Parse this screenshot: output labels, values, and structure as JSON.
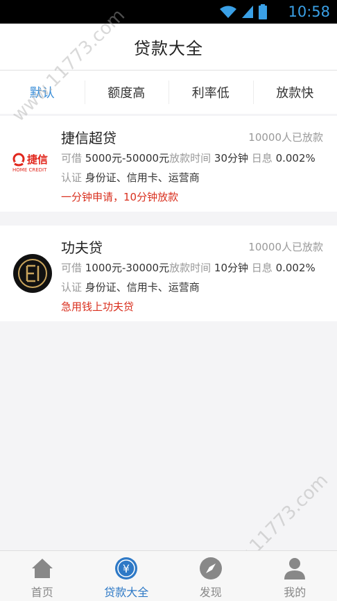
{
  "status_bar": {
    "time": "10:58",
    "icons": [
      "wifi-icon",
      "cell-signal-icon",
      "battery-icon"
    ]
  },
  "header": {
    "title": "贷款大全"
  },
  "tabs": [
    {
      "label": "默认",
      "active": true
    },
    {
      "label": "额度高",
      "active": false
    },
    {
      "label": "利率低",
      "active": false
    },
    {
      "label": "放款快",
      "active": false
    }
  ],
  "loans": [
    {
      "logo_text": "捷信",
      "logo_sub": "HOME CREDIT",
      "name": "捷信超贷",
      "count": "10000人已放款",
      "amount_label": "可借",
      "amount": "5000元-50000元",
      "time_label": "放款时间",
      "time": "30分钟",
      "rate_label": "日息",
      "rate": "0.002%",
      "cert_label": "认证",
      "cert": "身份证、信用卡、运营商",
      "slogan": "一分钟申请，10分钟放款"
    },
    {
      "logo_text": "",
      "logo_sub": "",
      "name": "功夫贷",
      "count": "10000人已放款",
      "amount_label": "可借",
      "amount": "1000元-30000元",
      "time_label": "放款时间",
      "time": "10分钟",
      "rate_label": "日息",
      "rate": "0.002%",
      "cert_label": "认证",
      "cert": "身份证、信用卡、运营商",
      "slogan": "急用钱上功夫贷"
    }
  ],
  "bottom_nav": [
    {
      "label": "首页",
      "icon": "home-icon",
      "active": false
    },
    {
      "label": "贷款大全",
      "icon": "yuan-icon",
      "active": true
    },
    {
      "label": "发现",
      "icon": "compass-icon",
      "active": false
    },
    {
      "label": "我的",
      "icon": "user-icon",
      "active": false
    }
  ],
  "watermark": "www.11773.com",
  "colors": {
    "accent": "#3a8ed8",
    "slogan": "#d9301f",
    "nav_active": "#2e79c6",
    "status_time": "#3aa0e6"
  }
}
